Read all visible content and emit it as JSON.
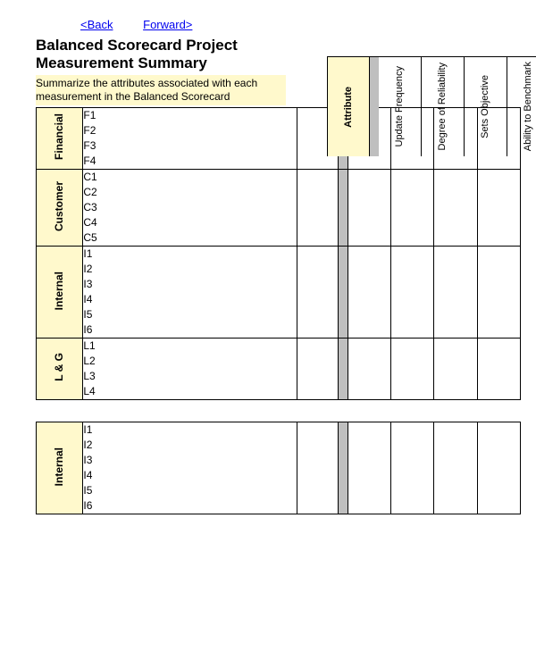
{
  "nav": {
    "back": "<Back",
    "forward": "Forward>"
  },
  "title": "Balanced Scorecard Project Measurement Summary",
  "subtitle": "Summarize the attributes associated with each measurement in the Balanced Scorecard",
  "columns": {
    "attribute": "Attribute",
    "c1": "Update Frequency",
    "c2": "Degree of Reliability",
    "c3": "Sets Objective",
    "c4": "Ability to Benchmark"
  },
  "groups": [
    {
      "name": "Financial",
      "items": [
        "F1",
        "F2",
        "F3",
        "F4"
      ]
    },
    {
      "name": "Customer",
      "items": [
        "C1",
        "C2",
        "C3",
        "C4",
        "C5"
      ]
    },
    {
      "name": "Internal",
      "items": [
        "I1",
        "I2",
        "I3",
        "I4",
        "I5",
        "I6"
      ]
    },
    {
      "name": "L & G",
      "items": [
        "L1",
        "L2",
        "L3",
        "L4"
      ]
    }
  ],
  "groups2": [
    {
      "name": "Internal",
      "items": [
        "I1",
        "I2",
        "I3",
        "I4",
        "I5",
        "I6"
      ]
    }
  ]
}
